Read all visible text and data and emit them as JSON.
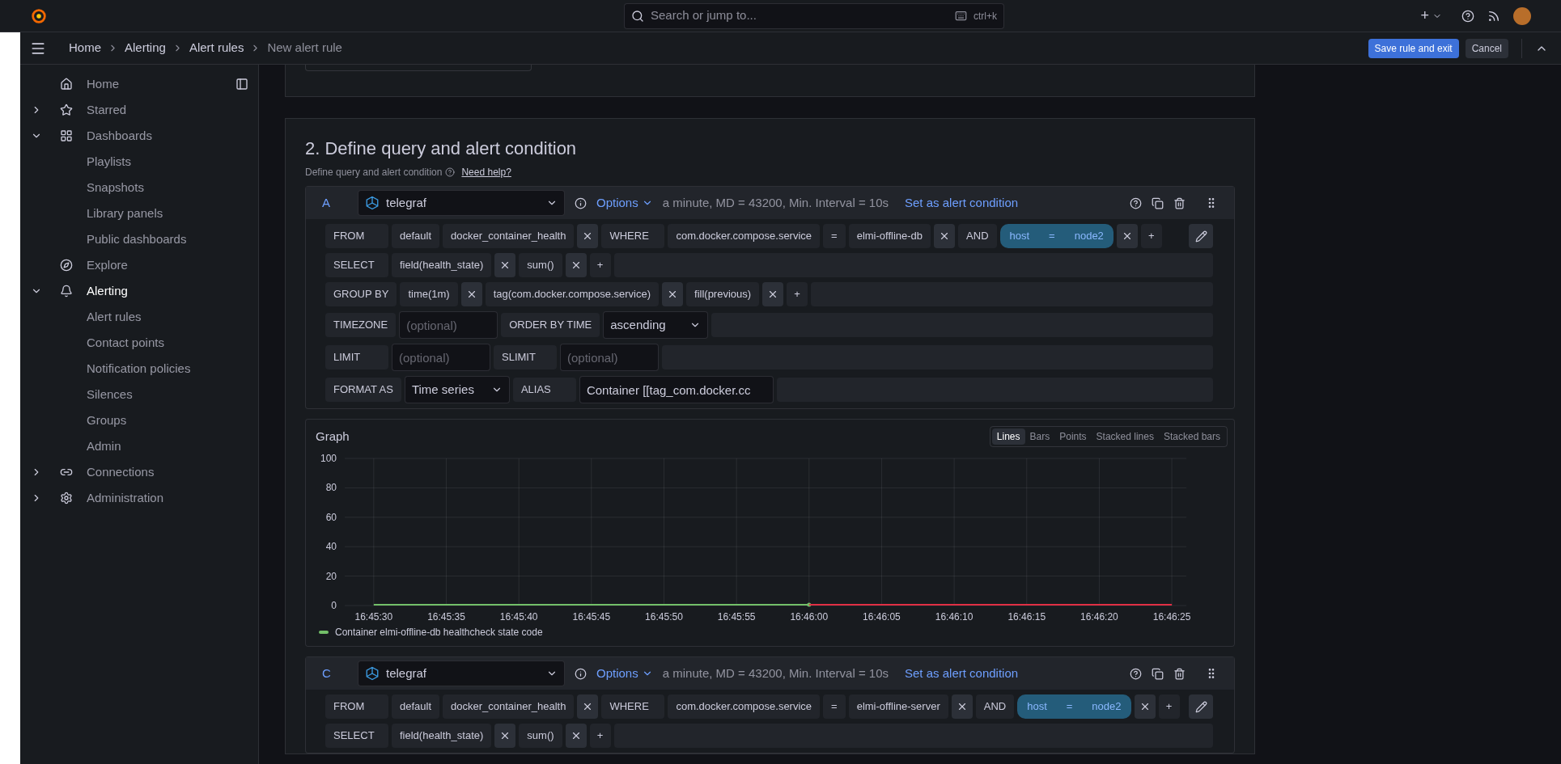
{
  "top_bar": {
    "search": {
      "placeholder": "Search or jump to..."
    },
    "shortcut": "ctrl+k",
    "new_button": "+"
  },
  "breadcrumbs": [
    {
      "label": "Home",
      "current": false
    },
    {
      "label": "Alerting",
      "current": false
    },
    {
      "label": "Alert rules",
      "current": false
    },
    {
      "label": "New alert rule",
      "current": true
    }
  ],
  "actions": [
    {
      "label": "Save rule and exit",
      "kind": "primary"
    },
    {
      "label": "Cancel",
      "kind": "secondary"
    }
  ],
  "sidebar": {
    "items": [
      {
        "label": "Home",
        "selected": false
      },
      {
        "label": "Starred",
        "expanded": false,
        "selected": false
      },
      {
        "label": "Dashboards",
        "expanded": true,
        "selected": false,
        "children": [
          {
            "label": "Playlists"
          },
          {
            "label": "Snapshots"
          },
          {
            "label": "Library panels"
          },
          {
            "label": "Public dashboards"
          }
        ]
      },
      {
        "label": "Explore",
        "selected": false
      },
      {
        "label": "Alerting",
        "expanded": true,
        "selected": true,
        "children": [
          {
            "label": "Alert rules"
          },
          {
            "label": "Contact points"
          },
          {
            "label": "Notification policies"
          },
          {
            "label": "Silences"
          },
          {
            "label": "Groups"
          },
          {
            "label": "Admin"
          }
        ]
      },
      {
        "label": "Connections",
        "expanded": false,
        "selected": false
      },
      {
        "label": "Administration",
        "expanded": false,
        "selected": false
      }
    ]
  },
  "section": {
    "title": "2. Define query and alert condition",
    "subtitle": "Define query and alert condition",
    "help_link": "Need help?"
  },
  "queries": [
    {
      "ref": "A",
      "datasource": "telegraf",
      "options": "Options",
      "info": "a minute, MD = 43200, Min. Interval = 10s",
      "condition_link": "Set as alert condition",
      "rows": [
        {
          "parts": [
            {
              "kind": "keyword",
              "text": "FROM"
            },
            {
              "kind": "chip",
              "text": "default"
            },
            {
              "kind": "chip",
              "text": "docker_container_health"
            },
            {
              "kind": "remove"
            },
            {
              "kind": "keyword",
              "text": "WHERE"
            },
            {
              "kind": "chip",
              "text": "com.docker.compose.service"
            },
            {
              "kind": "chip",
              "text": "="
            },
            {
              "kind": "chip",
              "text": "elmi-offline-db"
            },
            {
              "kind": "remove"
            },
            {
              "kind": "chip",
              "text": "AND"
            },
            {
              "kind": "highlight",
              "parts": [
                "host",
                "=",
                "node2"
              ]
            },
            {
              "kind": "remove"
            },
            {
              "kind": "add",
              "text": "+"
            },
            {
              "kind": "edit"
            }
          ]
        },
        {
          "parts": [
            {
              "kind": "keyword",
              "text": "SELECT"
            },
            {
              "kind": "chip",
              "text": "field(health_state)"
            },
            {
              "kind": "remove"
            },
            {
              "kind": "chip",
              "text": "sum()"
            },
            {
              "kind": "remove"
            },
            {
              "kind": "add",
              "text": "+"
            }
          ]
        },
        {
          "parts": [
            {
              "kind": "keyword",
              "text": "GROUP BY"
            },
            {
              "kind": "chip",
              "text": "time(1m)"
            },
            {
              "kind": "remove"
            },
            {
              "kind": "chip",
              "text": "tag(com.docker.compose.service)"
            },
            {
              "kind": "remove"
            },
            {
              "kind": "chip",
              "text": "fill(previous)"
            },
            {
              "kind": "remove"
            },
            {
              "kind": "add",
              "text": "+"
            }
          ]
        },
        {
          "parts": [
            {
              "kind": "keyword",
              "text": "TIMEZONE"
            },
            {
              "kind": "input",
              "placeholder": "(optional)"
            },
            {
              "kind": "keyword",
              "text": "ORDER BY TIME"
            },
            {
              "kind": "select",
              "value": "ascending"
            }
          ]
        },
        {
          "parts": [
            {
              "kind": "keyword",
              "text": "LIMIT"
            },
            {
              "kind": "input",
              "placeholder": "(optional)"
            },
            {
              "kind": "keyword",
              "text": "SLIMIT"
            },
            {
              "kind": "input",
              "placeholder": "(optional)"
            }
          ]
        },
        {
          "parts": [
            {
              "kind": "keyword",
              "text": "FORMAT AS"
            },
            {
              "kind": "select",
              "value": "Time series"
            },
            {
              "kind": "keyword",
              "text": "ALIAS"
            },
            {
              "kind": "input",
              "value": "Container [[tag_com.docker.cc"
            }
          ]
        }
      ],
      "graph": {
        "title": "Graph",
        "modes": [
          {
            "label": "Lines",
            "selected": true
          },
          {
            "label": "Bars",
            "selected": false
          },
          {
            "label": "Points",
            "selected": false
          },
          {
            "label": "Stacked lines",
            "selected": false
          },
          {
            "label": "Stacked bars",
            "selected": false
          }
        ],
        "chart_data": {
          "type": "line",
          "x": [
            "16:45:30",
            "16:45:35",
            "16:45:40",
            "16:45:45",
            "16:45:50",
            "16:45:55",
            "16:46:00",
            "16:46:05",
            "16:46:10",
            "16:46:15",
            "16:46:20",
            "16:46:25"
          ],
          "series": [
            {
              "name": "Container elmi-offline-db healthcheck state code",
              "color": "#73bf69",
              "values": [
                0,
                0,
                0,
                0,
                0,
                0,
                0,
                null,
                null,
                null,
                null,
                null
              ]
            },
            {
              "color": "#e02f44",
              "values": [
                null,
                null,
                null,
                null,
                null,
                null,
                0,
                0,
                0,
                0,
                0,
                0
              ]
            }
          ],
          "ylim": [
            0,
            100
          ],
          "yticks": [
            0,
            20,
            40,
            60,
            80,
            100
          ],
          "grid": true
        }
      }
    },
    {
      "ref": "C",
      "datasource": "telegraf",
      "options": "Options",
      "info": "a minute, MD = 43200, Min. Interval = 10s",
      "condition_link": "Set as alert condition",
      "rows": [
        {
          "parts": [
            {
              "kind": "keyword",
              "text": "FROM"
            },
            {
              "kind": "chip",
              "text": "default"
            },
            {
              "kind": "chip",
              "text": "docker_container_health"
            },
            {
              "kind": "remove"
            },
            {
              "kind": "keyword",
              "text": "WHERE"
            },
            {
              "kind": "chip",
              "text": "com.docker.compose.service"
            },
            {
              "kind": "chip",
              "text": "="
            },
            {
              "kind": "chip",
              "text": "elmi-offline-server"
            },
            {
              "kind": "remove"
            },
            {
              "kind": "chip",
              "text": "AND"
            },
            {
              "kind": "highlight",
              "parts": [
                "host",
                "=",
                "node2"
              ]
            },
            {
              "kind": "remove"
            },
            {
              "kind": "add",
              "text": "+"
            },
            {
              "kind": "edit"
            }
          ]
        },
        {
          "parts": [
            {
              "kind": "keyword",
              "text": "SELECT"
            },
            {
              "kind": "chip",
              "text": "field(health_state)"
            },
            {
              "kind": "remove"
            },
            {
              "kind": "chip",
              "text": "sum()"
            },
            {
              "kind": "remove"
            },
            {
              "kind": "add",
              "text": "+"
            }
          ]
        }
      ]
    }
  ]
}
